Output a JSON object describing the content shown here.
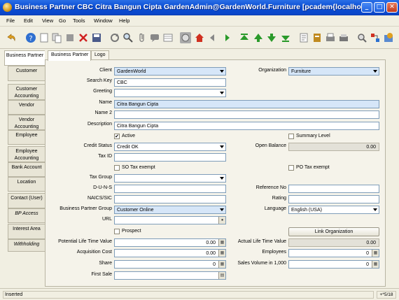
{
  "window": {
    "title": "Business Partner  CBC  Citra Bangun Cipta  GardenAdmin@GardenWorld.Furniture [pcadem{localhost-adempiere-ad...",
    "minimize": "_",
    "maximize": "□",
    "close": "✕"
  },
  "menu": [
    "File",
    "Edit",
    "View",
    "Go",
    "Tools",
    "Window",
    "Help"
  ],
  "left_tabs": [
    {
      "label": "Business Partner"
    },
    {
      "label": "Customer"
    },
    {
      "label": "Customer Accounting"
    },
    {
      "label": "Vendor"
    },
    {
      "label": "Vendor Accounting"
    },
    {
      "label": "Employee"
    },
    {
      "label": "Employee Accounting"
    },
    {
      "label": "Bank Account"
    },
    {
      "label": "Location"
    },
    {
      "label": "Contact (User)"
    },
    {
      "label": "BP Access"
    },
    {
      "label": "Interest Area"
    },
    {
      "label": "Withholding"
    }
  ],
  "top_tabs": [
    "Business Partner",
    "Logo"
  ],
  "form": {
    "client_label": "Client",
    "client_value": "GardenWorld",
    "organization_label": "Organization",
    "organization_value": "Furniture",
    "search_key_label": "Search Key",
    "search_key_value": "CBC",
    "greeting_label": "Greeting",
    "greeting_value": "",
    "name_label": "Name",
    "name_value": "Citra Bangun Cipta",
    "name2_label": "Name 2",
    "name2_value": "",
    "description_label": "Description",
    "description_value": "Citra Bangun Cipta",
    "active_label": "Active",
    "active_checked": "✔",
    "summary_level_label": "Summary Level",
    "credit_status_label": "Credit Status",
    "credit_status_value": "Credit OK",
    "open_balance_label": "Open Balance",
    "open_balance_value": "0.00",
    "tax_id_label": "Tax ID",
    "tax_id_value": "",
    "so_tax_exempt_label": "SO Tax exempt",
    "po_tax_exempt_label": "PO Tax exempt",
    "tax_group_label": "Tax Group",
    "tax_group_value": "",
    "duns_label": "D-U-N-S",
    "duns_value": "",
    "reference_no_label": "Reference No",
    "reference_no_value": "",
    "naics_label": "NAICS/SIC",
    "naics_value": "",
    "rating_label": "Rating",
    "rating_value": "",
    "bp_group_label": "Business Partner Group",
    "bp_group_value": "Customer Online",
    "language_label": "Language",
    "language_value": "English (USA)",
    "url_label": "URL",
    "url_value": "",
    "prospect_label": "Prospect",
    "link_org_label": "Link Organization",
    "potential_ltv_label": "Potential Life Time Value",
    "potential_ltv_value": "0.00",
    "actual_ltv_label": "Actual Life Time Value",
    "actual_ltv_value": "0.00",
    "acquisition_cost_label": "Acquisition Cost",
    "acquisition_cost_value": "0.00",
    "employees_label": "Employees",
    "employees_value": "0",
    "share_label": "Share",
    "share_value": "0",
    "sales_volume_label": "Sales Volume in 1,000",
    "sales_volume_value": "0",
    "first_sale_label": "First Sale",
    "first_sale_value": ""
  },
  "status": {
    "message": "Inserted",
    "record": "+*5/18"
  }
}
